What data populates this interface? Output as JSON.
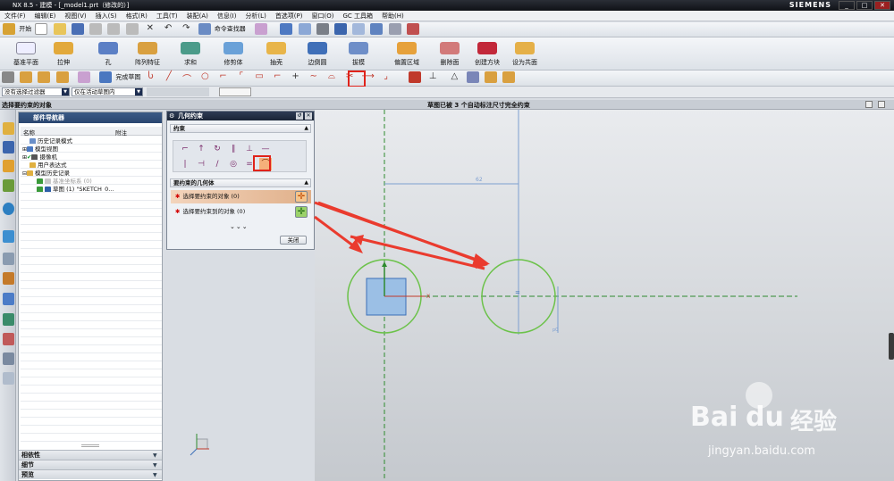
{
  "window": {
    "title": "NX 8.5 - 建模 - [_model1.prt（修改的）]",
    "brand": "SIEMENS",
    "controls": [
      "_",
      "□",
      "✕"
    ]
  },
  "menu": [
    "文件(F)",
    "编辑(E)",
    "视图(V)",
    "插入(S)",
    "格式(R)",
    "工具(T)",
    "装配(A)",
    "信息(I)",
    "分析(L)",
    "首选项(P)",
    "窗口(O)",
    "GC 工具箱",
    "帮助(H)"
  ],
  "toolbar1": {
    "start": "开始",
    "command_finder": "命令查找器"
  },
  "toolbar2": [
    "基准平面",
    "拉伸",
    "孔",
    "阵列特征",
    "求和",
    "修剪体",
    "抽壳",
    "边倒圆",
    "拔模",
    "偏置区域",
    "删除面",
    "创建方块",
    "设为共面"
  ],
  "toolbar3": {
    "finish_sketch": "完成草图"
  },
  "filters": {
    "select_filter": "没有选择过滤器",
    "scope": "仅在活动草图内"
  },
  "status": {
    "prompt": "选择要约束的对象",
    "message": "草图已被 3 个自动标注尺寸完全约束"
  },
  "navigator": {
    "title": "部件导航器",
    "columns": [
      "名称",
      "附注"
    ],
    "items": [
      "历史记录模式",
      "模型视图",
      "摄像机",
      "用户表达式",
      "模型历史记录",
      "基准坐标系 (0)",
      "草图 (1) \"SKETCH_0..."
    ],
    "sections": [
      "相依性",
      "细节",
      "预览"
    ]
  },
  "dialog": {
    "title": "几何约束",
    "constraint_section": "约束",
    "geometry_section": "要约束的几何体",
    "row1": "选择要约束的对象 (0)",
    "row2": "选择要约束到的对象 (0)",
    "close": "关闭"
  },
  "canvas": {
    "dim_label": "62",
    "dim_label2": "p0"
  },
  "watermark": {
    "brand_a": "Bai",
    "brand_b": "du",
    "brand_c": "经验",
    "url": "jingyan.baidu.com"
  },
  "colors": {
    "highlight": "#e0231b",
    "sketch_green": "#2e8b2e",
    "circle_green": "#6cc24a",
    "dim_blue": "#7d9fd0"
  }
}
